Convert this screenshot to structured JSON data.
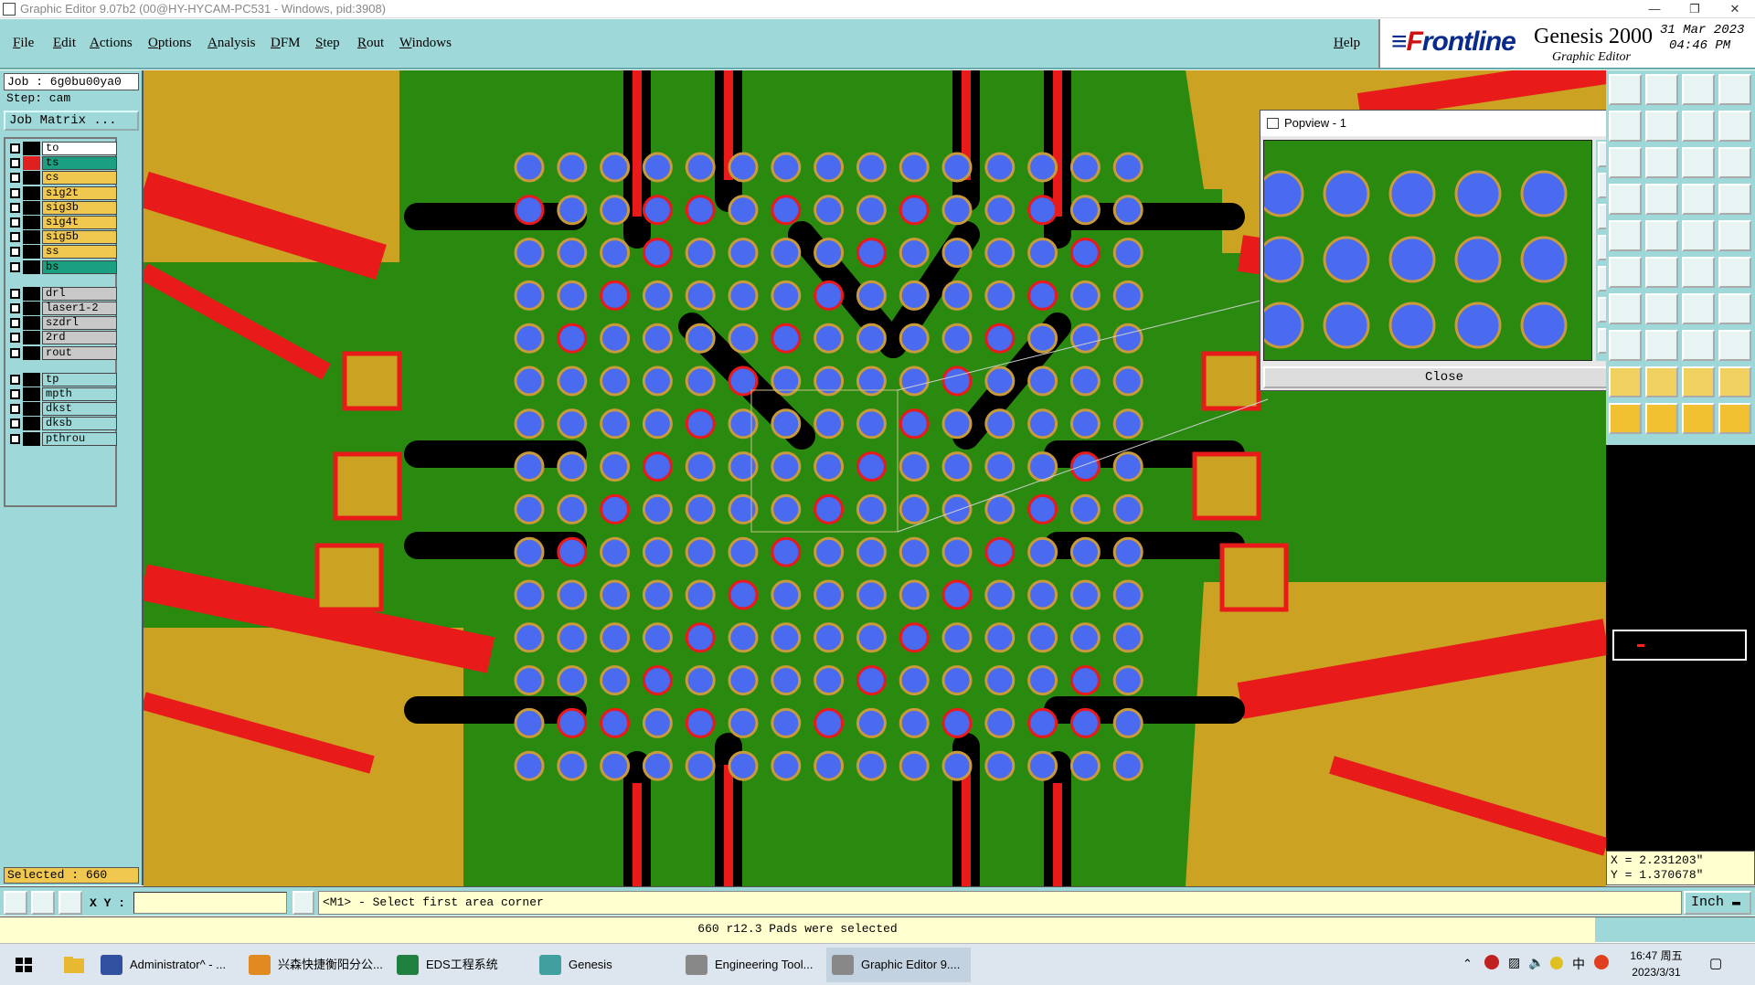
{
  "window": {
    "title": "Graphic Editor 9.07b2 (00@HY-HYCAM-PC531 - Windows, pid:3908)"
  },
  "menu": {
    "items": [
      "File",
      "Edit",
      "Actions",
      "Options",
      "Analysis",
      "DFM",
      "Step",
      "Rout",
      "Windows"
    ],
    "help": "Help"
  },
  "brand": {
    "logo_f": "F",
    "logo_rest": "rontline",
    "title": "Genesis 2000",
    "subtitle": "Graphic Editor",
    "date": "31 Mar 2023",
    "time": "04:46 PM"
  },
  "left": {
    "job": "Job : 6g0bu00ya0",
    "step": "Step: cam",
    "job_matrix": "Job Matrix ...",
    "selected": "Selected : 660",
    "layers": [
      {
        "name": "to",
        "bg": "#ffffff",
        "mark": "#000000"
      },
      {
        "name": "ts",
        "bg": "#1aa080",
        "mark": "#e02020"
      },
      {
        "name": "cs",
        "bg": "#f0c850",
        "mark": "#000000"
      },
      {
        "name": "sig2t",
        "bg": "#f0c850",
        "mark": "#000000"
      },
      {
        "name": "sig3b",
        "bg": "#f0c850",
        "mark": "#000000"
      },
      {
        "name": "sig4t",
        "bg": "#f0c850",
        "mark": "#000000"
      },
      {
        "name": "sig5b",
        "bg": "#f0c850",
        "mark": "#000000"
      },
      {
        "name": "ss",
        "bg": "#f0c850",
        "mark": "#000000"
      },
      {
        "name": "bs",
        "bg": "#1aa080",
        "mark": "#000000"
      },
      {
        "name": "drl",
        "bg": "#c8c8c8",
        "mark": "#000000"
      },
      {
        "name": "laser1-2",
        "bg": "#c8c8c8",
        "mark": "#000000"
      },
      {
        "name": "szdrl",
        "bg": "#c8c8c8",
        "mark": "#000000"
      },
      {
        "name": "2rd",
        "bg": "#c8c8c8",
        "mark": "#000000"
      },
      {
        "name": "rout",
        "bg": "#c8c8c8",
        "mark": "#000000"
      },
      {
        "name": "tp",
        "bg": "#9ed8d8",
        "mark": "#000000"
      },
      {
        "name": "mpth",
        "bg": "#9ed8d8",
        "mark": "#000000"
      },
      {
        "name": "dkst",
        "bg": "#9ed8d8",
        "mark": "#000000"
      },
      {
        "name": "dksb",
        "bg": "#9ed8d8",
        "mark": "#000000"
      },
      {
        "name": "pthrou",
        "bg": "#9ed8d8",
        "mark": "#000000"
      }
    ]
  },
  "popview": {
    "title": "Popview - 1",
    "close": "Close"
  },
  "coords": {
    "x": "X = 2.231203\"",
    "y": "Y = 1.370678\""
  },
  "command": {
    "xy_label": "X Y :",
    "xy_value": "",
    "prompt": "<M1> - Select first area corner",
    "unit": "Inch"
  },
  "status": {
    "message": "660 r12.3 Pads were selected"
  },
  "colors": {
    "copper": "#2a8a10",
    "mask": "#000000",
    "trace": "#e81a1a",
    "pad": "#4a6af0",
    "pad_ring": "#c89a3a",
    "gold": "#cba222",
    "panel": "#9ed8d8"
  },
  "taskbar": {
    "items": [
      {
        "label": "Administrator^ - ...",
        "icon": "#3050a0"
      },
      {
        "label": "兴森快捷衡阳分公...",
        "icon": "#e08a20"
      },
      {
        "label": "EDS工程系统",
        "icon": "#208040"
      },
      {
        "label": "Genesis",
        "icon": "#40a0a0"
      },
      {
        "label": "Engineering Tool...",
        "icon": "#888888"
      },
      {
        "label": "Graphic Editor 9....",
        "icon": "#888888"
      }
    ],
    "clock_time": "16:47 周五",
    "clock_date": "2023/3/31",
    "ime": "中"
  }
}
